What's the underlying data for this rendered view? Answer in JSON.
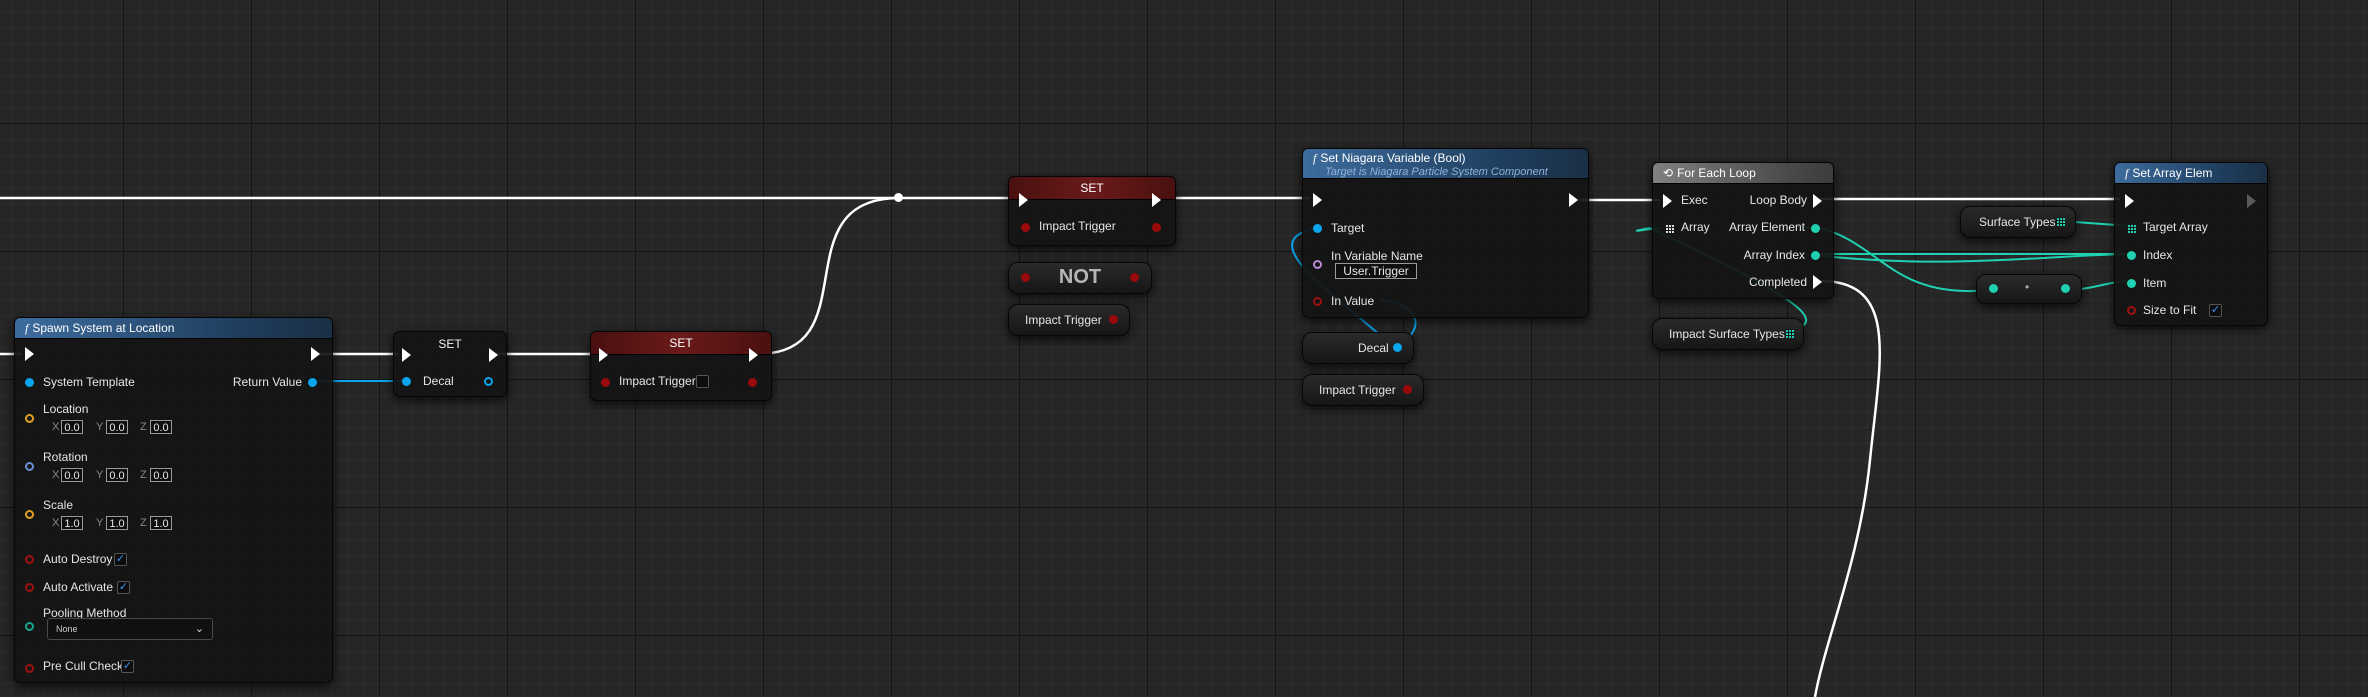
{
  "nodes": {
    "spawn_system": {
      "title": "Spawn System at Location",
      "system_template": "System Template",
      "return_value": "Return Value",
      "location": "Location",
      "rotation": "Rotation",
      "scale": "Scale",
      "axis_x": "X",
      "axis_y": "Y",
      "axis_z": "Z",
      "location_values": [
        "0.0",
        "0.0",
        "0.0"
      ],
      "rotation_values": [
        "0.0",
        "0.0",
        "0.0"
      ],
      "scale_values": [
        "1.0",
        "1.0",
        "1.0"
      ],
      "auto_destroy": "Auto Destroy",
      "auto_activate": "Auto Activate",
      "pooling_method": "Pooling Method",
      "pooling_value": "None",
      "pre_cull_check": "Pre Cull Check",
      "checkmark": "✓"
    },
    "set_decal": {
      "title": "SET",
      "pin": "Decal"
    },
    "set_impact_1": {
      "title": "SET",
      "pin": "Impact Trigger"
    },
    "set_impact_2": {
      "title": "SET",
      "pin": "Impact Trigger"
    },
    "not_node": {
      "title": "NOT"
    },
    "impact_getter_1": {
      "label": "Impact Trigger"
    },
    "set_niagara": {
      "title": "Set Niagara Variable (Bool)",
      "subtitle": "Target is Niagara Particle System Component",
      "target": "Target",
      "in_variable_name": "In Variable Name",
      "in_variable_value": "User.Trigger",
      "in_value": "In Value"
    },
    "decal_getter": {
      "label": "Decal"
    },
    "impact_getter_2": {
      "label": "Impact Trigger"
    },
    "for_each": {
      "title": "For Each Loop",
      "exec": "Exec",
      "array": "Array",
      "loop_body": "Loop Body",
      "array_element": "Array Element",
      "array_index": "Array Index",
      "completed": "Completed"
    },
    "impact_surface_types": {
      "label": "Impact Surface Types"
    },
    "surface_types": {
      "label": "Surface Types"
    },
    "set_array_elem": {
      "title": "Set Array Elem",
      "target_array": "Target Array",
      "index": "Index",
      "item": "Item",
      "size_to_fit": "Size to Fit"
    }
  },
  "colors": {
    "exec_wire": "#ffffff",
    "object_wire": "#0aa5ee",
    "struct_wire": "#1fd1b0",
    "bool_pin": "#9a0a0a",
    "function_header": "#3d6c9e"
  }
}
